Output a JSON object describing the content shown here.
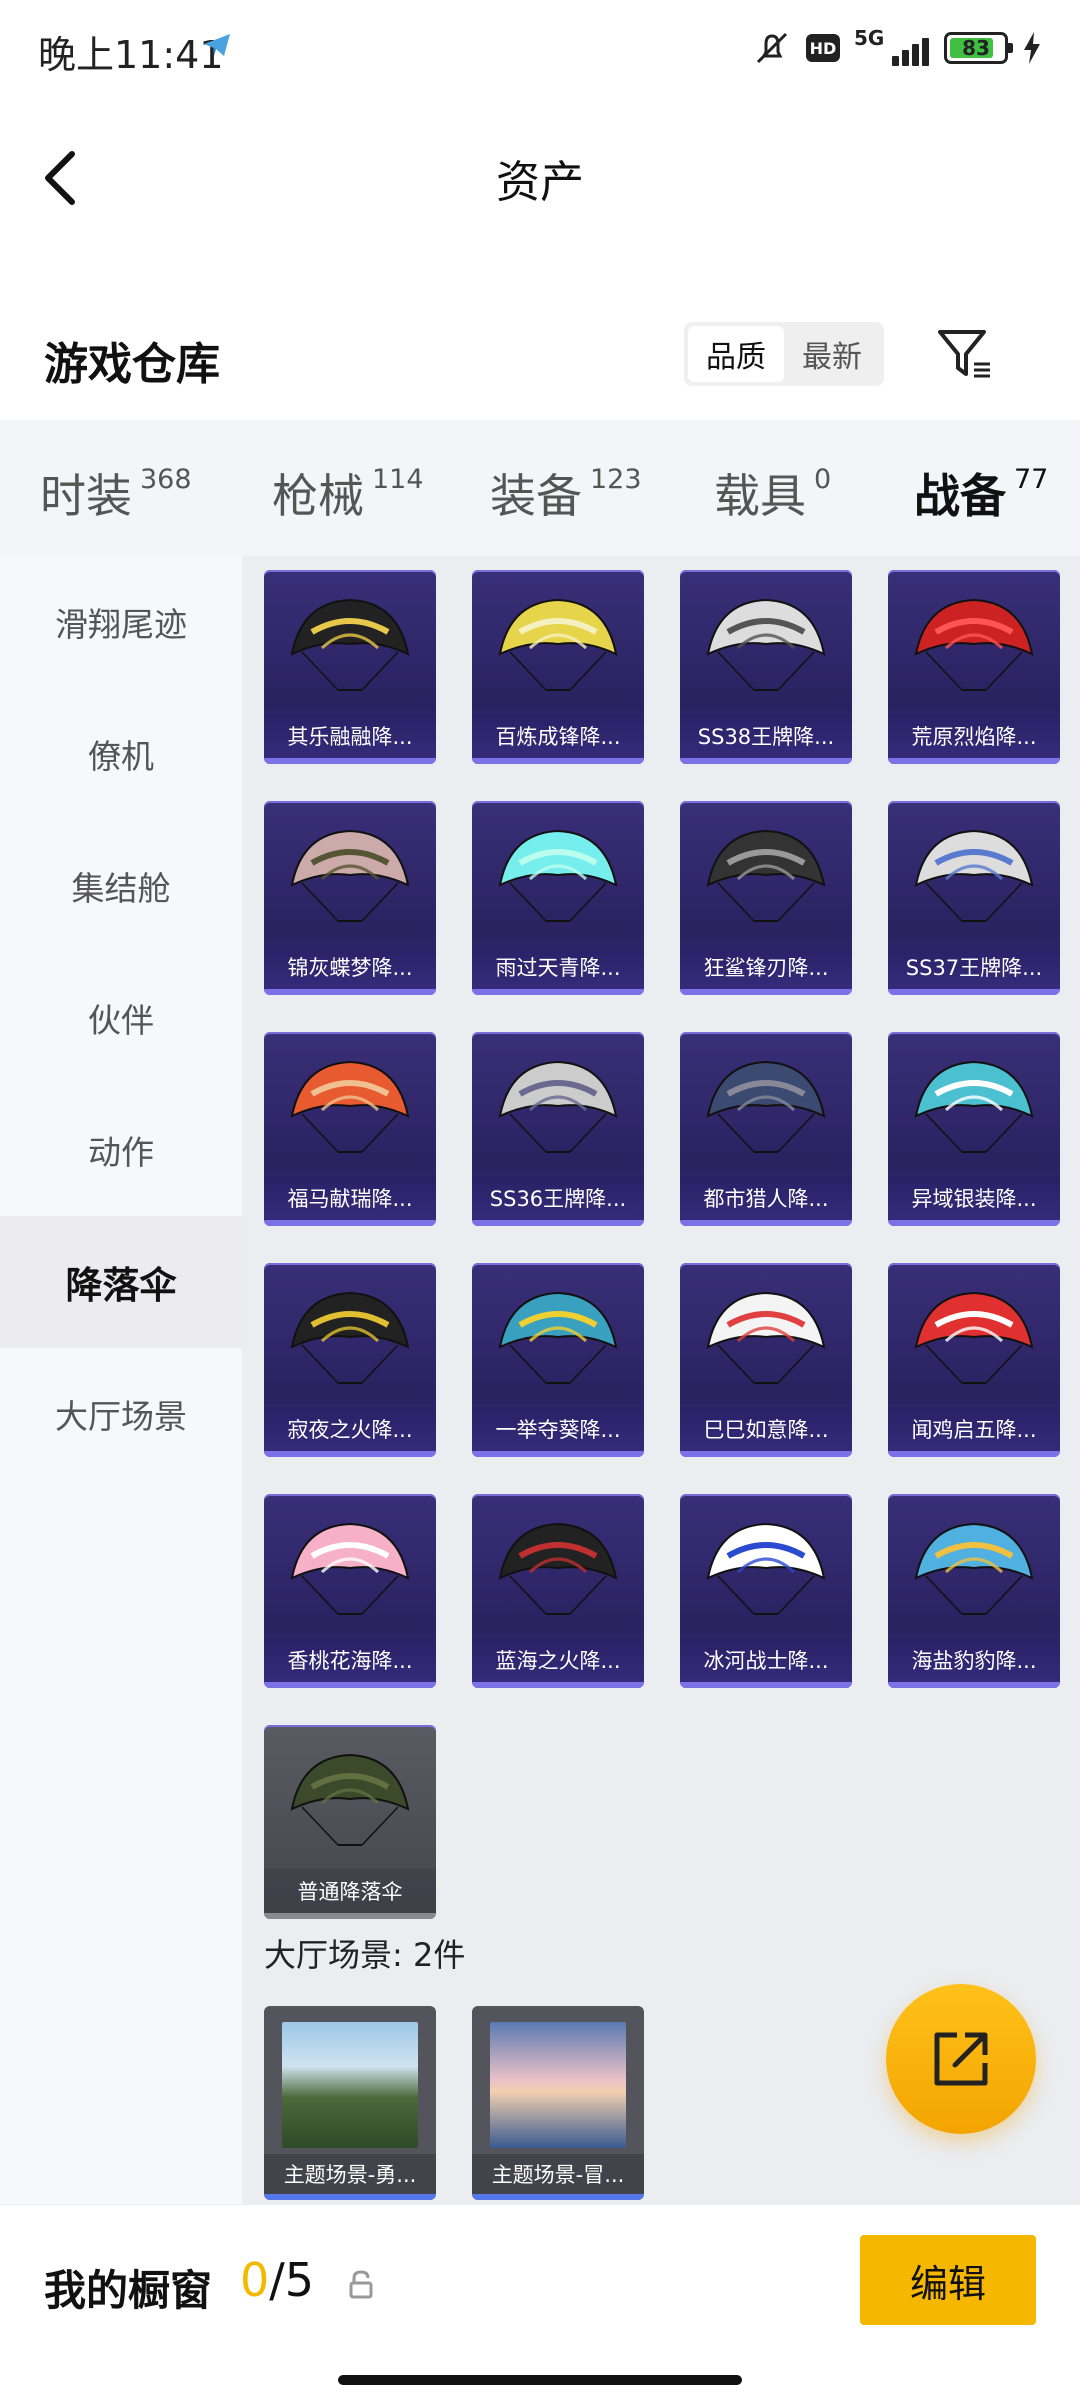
{
  "status_bar": {
    "time": "晚上11:41",
    "network": "5G",
    "battery": "83"
  },
  "header": {
    "title": "资产"
  },
  "section": {
    "title": "游戏仓库",
    "sort_quality": "品质",
    "sort_latest": "最新"
  },
  "tabs": [
    {
      "label": "时装",
      "count": "368"
    },
    {
      "label": "枪械",
      "count": "114"
    },
    {
      "label": "装备",
      "count": "123"
    },
    {
      "label": "载具",
      "count": "0"
    },
    {
      "label": "战备",
      "count": "77"
    }
  ],
  "sidebar": {
    "items": [
      "滑翔尾迹",
      "僚机",
      "集结舱",
      "伙伴",
      "动作",
      "降落伞",
      "大厅场景"
    ]
  },
  "parachutes": [
    {
      "label": "其乐融融降...",
      "c1": "#222",
      "c2": "#e8c84a"
    },
    {
      "label": "百炼成锋降...",
      "c1": "#e6d54a",
      "c2": "#f5f0c0"
    },
    {
      "label": "SS38王牌降...",
      "c1": "#ddd",
      "c2": "#555"
    },
    {
      "label": "荒原烈焰降...",
      "c1": "#c22",
      "c2": "#f55"
    },
    {
      "label": "锦灰蝶梦降...",
      "c1": "#caa",
      "c2": "#553"
    },
    {
      "label": "雨过天青降...",
      "c1": "#7ee",
      "c2": "#bfe"
    },
    {
      "label": "狂鲨锋刃降...",
      "c1": "#333",
      "c2": "#999"
    },
    {
      "label": "SS37王牌降...",
      "c1": "#ddd",
      "c2": "#5a7ad0"
    },
    {
      "label": "福马献瑞降...",
      "c1": "#e85a30",
      "c2": "#f0c090"
    },
    {
      "label": "SS36王牌降...",
      "c1": "#ccc",
      "c2": "#6a6a90"
    },
    {
      "label": "都市猎人降...",
      "c1": "#3a4a70",
      "c2": "#889"
    },
    {
      "label": "异域银装降...",
      "c1": "#4ac0d0",
      "c2": "#fff"
    },
    {
      "label": "寂夜之火降...",
      "c1": "#222",
      "c2": "#e0c030"
    },
    {
      "label": "一举夺葵降...",
      "c1": "#3aa0c0",
      "c2": "#f0d030"
    },
    {
      "label": "巳巳如意降...",
      "c1": "#f4f4f4",
      "c2": "#e04040"
    },
    {
      "label": "闻鸡启五降...",
      "c1": "#e03030",
      "c2": "#fff"
    },
    {
      "label": "香桃花海降...",
      "c1": "#f6b0c8",
      "c2": "#fff"
    },
    {
      "label": "蓝海之火降...",
      "c1": "#222",
      "c2": "#c03030"
    },
    {
      "label": "冰河战士降...",
      "c1": "#fff",
      "c2": "#2a4ad0"
    },
    {
      "label": "海盐豹豹降...",
      "c1": "#50b0e0",
      "c2": "#f0c040"
    },
    {
      "label": "普通降落伞",
      "c1": "#3a4a2a",
      "c2": "#607040",
      "gray": true
    }
  ],
  "lobby": {
    "header": "大厅场景: 2件",
    "items": [
      {
        "label": "主题场景-勇..."
      },
      {
        "label": "主题场景-冒..."
      }
    ]
  },
  "bottom": {
    "title": "我的橱窗",
    "count_current": "0",
    "count_total": "/5",
    "edit": "编辑"
  },
  "colors": {
    "accent": "#f6b700",
    "card_purple": "#2a2160"
  }
}
